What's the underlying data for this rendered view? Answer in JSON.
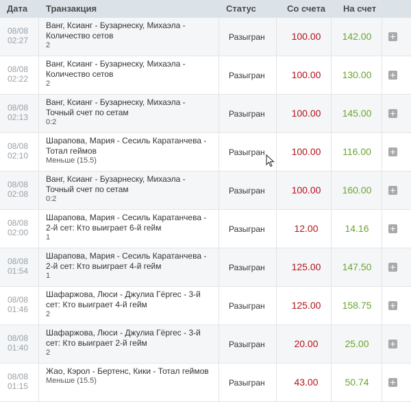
{
  "header": {
    "date": "Дата",
    "transaction": "Транзакция",
    "status": "Статус",
    "from_account": "Со счета",
    "to_account": "На счет"
  },
  "colors": {
    "header_bg": "#dce3e8",
    "debit": "#b5121b",
    "credit": "#6aa52d",
    "row_alt_bg": "#f4f6f8"
  },
  "rows": [
    {
      "date": "08/08",
      "time": "02:27",
      "title": "Ванг, Ксианг - Бузарнеску, Михаэла - Количество сетов",
      "pick": "2",
      "status": "Разыгран",
      "from": "100.00",
      "to": "142.00"
    },
    {
      "date": "08/08",
      "time": "02:22",
      "title": "Ванг, Ксианг - Бузарнеску, Михаэла - Количество сетов",
      "pick": "2",
      "status": "Разыгран",
      "from": "100.00",
      "to": "130.00"
    },
    {
      "date": "08/08",
      "time": "02:13",
      "title": "Ванг, Ксианг - Бузарнеску, Михаэла - Точный счет по сетам",
      "pick": "0:2",
      "status": "Разыгран",
      "from": "100.00",
      "to": "145.00"
    },
    {
      "date": "08/08",
      "time": "02:10",
      "title": "Шарапова, Мария - Сесиль Каратанчева - Тотал геймов",
      "pick": "Меньше (15.5)",
      "status": "Разыгран",
      "from": "100.00",
      "to": "116.00"
    },
    {
      "date": "08/08",
      "time": "02:08",
      "title": "Ванг, Ксианг - Бузарнеску, Михаэла - Точный счет по сетам",
      "pick": "0:2",
      "status": "Разыгран",
      "from": "100.00",
      "to": "160.00"
    },
    {
      "date": "08/08",
      "time": "02:00",
      "title": "Шарапова, Мария - Сесиль Каратанчева - 2-й сет: Кто выиграет 6-й гейм",
      "pick": "1",
      "status": "Разыгран",
      "from": "12.00",
      "to": "14.16"
    },
    {
      "date": "08/08",
      "time": "01:54",
      "title": "Шарапова, Мария - Сесиль Каратанчева - 2-й сет: Кто выиграет 4-й гейм",
      "pick": "1",
      "status": "Разыгран",
      "from": "125.00",
      "to": "147.50"
    },
    {
      "date": "08/08",
      "time": "01:46",
      "title": "Шафаржова, Люси - Джулиа Гёргес - 3-й сет: Кто выиграет 4-й гейм",
      "pick": "2",
      "status": "Разыгран",
      "from": "125.00",
      "to": "158.75"
    },
    {
      "date": "08/08",
      "time": "01:40",
      "title": "Шафаржова, Люси - Джулиа Гёргес - 3-й сет: Кто выиграет 2-й гейм",
      "pick": "2",
      "status": "Разыгран",
      "from": "20.00",
      "to": "25.00"
    },
    {
      "date": "08/08",
      "time": "01:15",
      "title": "Жао, Кэрол - Бертенс, Кики - Тотал геймов",
      "pick": "Меньше (15.5)",
      "status": "Разыгран",
      "from": "43.00",
      "to": "50.74"
    }
  ]
}
